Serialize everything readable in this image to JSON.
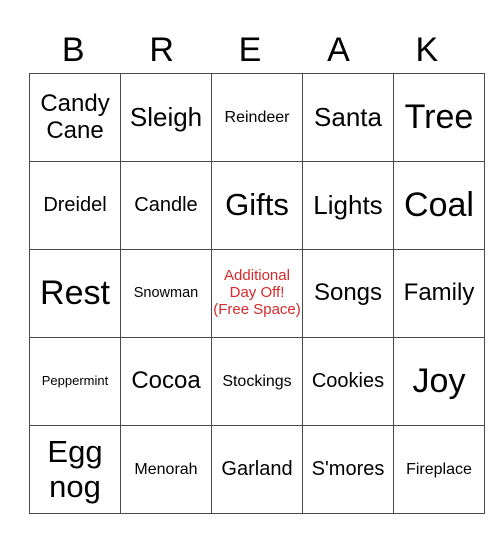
{
  "title_letters": [
    "B",
    "R",
    "E",
    "A",
    "K"
  ],
  "free_space_color": "#d52b2b",
  "rows": [
    [
      "Candy Cane",
      "Sleigh",
      "Reindeer",
      "Santa",
      "Tree"
    ],
    [
      "Dreidel",
      "Candle",
      "Gifts",
      "Lights",
      "Coal"
    ],
    [
      "Rest",
      "Snowman",
      "Additional Day Off! (Free Space)",
      "Songs",
      "Family"
    ],
    [
      "Peppermint",
      "Cocoa",
      "Stockings",
      "Cookies",
      "Joy"
    ],
    [
      "Egg nog",
      "Menorah",
      "Garland",
      "S'mores",
      "Fireplace"
    ]
  ]
}
